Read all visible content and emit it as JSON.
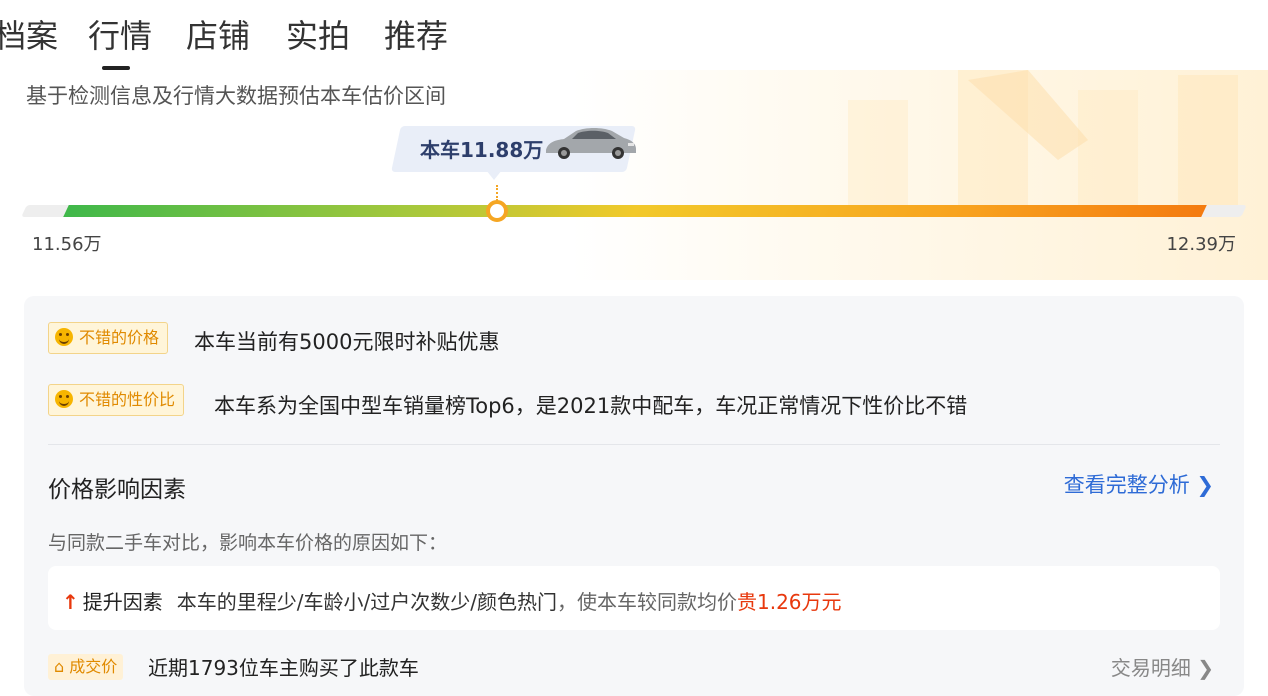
{
  "tabs": [
    {
      "label": "档案"
    },
    {
      "label": "行情"
    },
    {
      "label": "店铺"
    },
    {
      "label": "实拍"
    },
    {
      "label": "推荐"
    }
  ],
  "active_tab": "行情",
  "hero": {
    "subtitle": "基于检测信息及行情大数据预估本车估价区间",
    "car_tag": "本车11.88万",
    "price_low": "11.56万",
    "price_high": "12.39万",
    "car_price_position": 0.39
  },
  "highlights": [
    {
      "badge": "不错的价格",
      "text": "本车当前有5000元限时补贴优惠"
    },
    {
      "badge": "不错的性价比",
      "text": "本车系为全国中型车销量榜Top6，是2021款中配车，车况正常情况下性价比不错"
    }
  ],
  "factors": {
    "title": "价格影响因素",
    "link": "查看完整分析",
    "description": "与同款二手车对比，影响本车价格的原因如下：",
    "up_label": "提升因素",
    "up_main": "本车的里程少/车龄小/过户次数少/颜色热门",
    "up_sep": "，使本车较同款均价",
    "up_pricy": "贵1.26万元"
  },
  "deal": {
    "badge": "成交价",
    "text": "近期1793位车主购买了此款车",
    "link": "交易明细"
  },
  "colors": {
    "accent_blue": "#2e6bd6",
    "price_red": "#e8380d",
    "badge_orange": "#e08a00"
  }
}
